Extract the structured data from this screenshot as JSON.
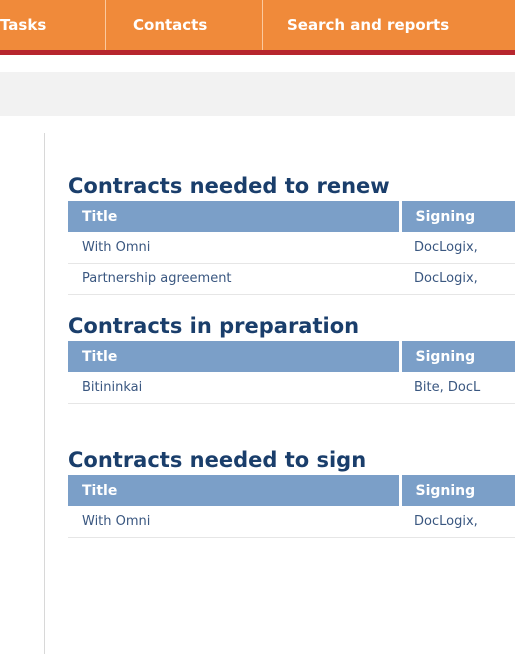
{
  "nav": {
    "tabs": [
      {
        "label": "Tasks"
      },
      {
        "label": "Contacts"
      },
      {
        "label": "Search and reports"
      }
    ]
  },
  "sections": [
    {
      "title": "Contracts needed to renew",
      "columns": [
        "Title",
        "Signing"
      ],
      "rows": [
        [
          "With Omni",
          "DocLogix,"
        ],
        [
          "Partnership agreement",
          "DocLogix,"
        ]
      ]
    },
    {
      "title": "Contracts in preparation",
      "columns": [
        "Title",
        "Signing"
      ],
      "rows": [
        [
          "Bitininkai",
          "Bite, DocL"
        ]
      ]
    },
    {
      "title": "Contracts needed to sign",
      "columns": [
        "Title",
        "Signing"
      ],
      "rows": [
        [
          "With Omni",
          "DocLogix,"
        ]
      ]
    }
  ]
}
